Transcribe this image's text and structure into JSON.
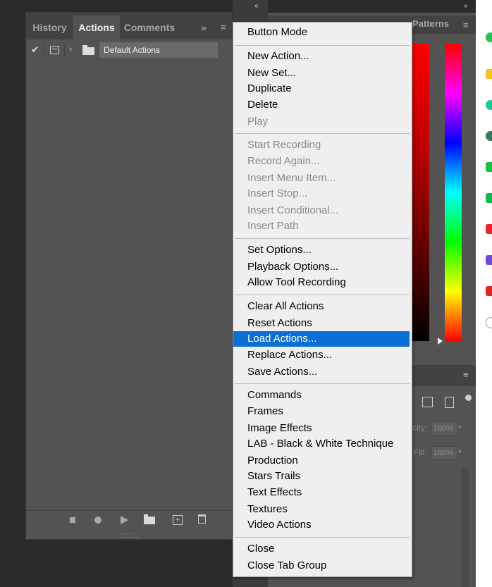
{
  "actions_panel": {
    "tabs": [
      {
        "label": "History"
      },
      {
        "label": "Actions"
      },
      {
        "label": "Comments"
      }
    ],
    "overflow_icon": "double-chevron-right-icon",
    "menu_icon": "hamburger-menu-icon",
    "action_set": {
      "name": "Default Actions",
      "checked": true
    },
    "bottom_buttons": [
      "stop-icon",
      "record-icon",
      "play-icon",
      "new-set-folder-icon",
      "new-action-icon",
      "trash-icon"
    ]
  },
  "right_panel": {
    "visible_tab": "Patterns",
    "opacity_label": "city:",
    "opacity_value": "100%",
    "fill_label": "Fill:",
    "fill_value": "100%"
  },
  "context_menu": {
    "groups": [
      [
        {
          "label": "Button Mode",
          "enabled": true
        }
      ],
      [
        {
          "label": "New Action...",
          "enabled": true
        },
        {
          "label": "New Set...",
          "enabled": true
        },
        {
          "label": "Duplicate",
          "enabled": true
        },
        {
          "label": "Delete",
          "enabled": true
        },
        {
          "label": "Play",
          "enabled": false
        }
      ],
      [
        {
          "label": "Start Recording",
          "enabled": false
        },
        {
          "label": "Record Again...",
          "enabled": false
        },
        {
          "label": "Insert Menu Item...",
          "enabled": false
        },
        {
          "label": "Insert Stop...",
          "enabled": false
        },
        {
          "label": "Insert Conditional...",
          "enabled": false
        },
        {
          "label": "Insert Path",
          "enabled": false
        }
      ],
      [
        {
          "label": "Set Options...",
          "enabled": true
        },
        {
          "label": "Playback Options...",
          "enabled": true
        },
        {
          "label": "Allow Tool Recording",
          "enabled": true
        }
      ],
      [
        {
          "label": "Clear All Actions",
          "enabled": true
        },
        {
          "label": "Reset Actions",
          "enabled": true
        },
        {
          "label": "Load Actions...",
          "enabled": true,
          "highlighted": true
        },
        {
          "label": "Replace Actions...",
          "enabled": true
        },
        {
          "label": "Save Actions...",
          "enabled": true
        }
      ],
      [
        {
          "label": "Commands",
          "enabled": true
        },
        {
          "label": "Frames",
          "enabled": true
        },
        {
          "label": "Image Effects",
          "enabled": true
        },
        {
          "label": "LAB - Black & White Technique",
          "enabled": true
        },
        {
          "label": "Production",
          "enabled": true
        },
        {
          "label": "Stars Trails",
          "enabled": true
        },
        {
          "label": "Text Effects",
          "enabled": true
        },
        {
          "label": "Textures",
          "enabled": true
        },
        {
          "label": "Video Actions",
          "enabled": true
        }
      ],
      [
        {
          "label": "Close",
          "enabled": true
        },
        {
          "label": "Close Tab Group",
          "enabled": true
        }
      ]
    ],
    "highlight_color": "#0a6fd4",
    "disabled_color": "#8b8b8b"
  }
}
